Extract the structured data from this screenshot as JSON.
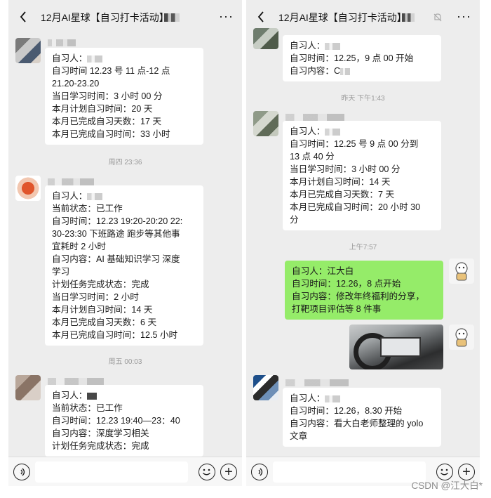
{
  "left": {
    "title": "12月AI星球【自习打卡活动】",
    "messages": [
      {
        "lines": [
          "自习人：",
          "自习时间   12.23 号 11 点-12 点",
          "21.20-23.20",
          "当日学习时间：3 小时 00 分",
          "本月计划自习时间：20 天",
          "本月已完成自习天数：17 天",
          "本月已完成自习时间：33 小时"
        ]
      },
      {
        "lines": [
          "自习人：",
          "当前状态：已工作",
          "自习时间：12.23 19:20-20:20 22:",
          "30-23:30 下班路途 跑步等其他事",
          "宜耗时 2 小时",
          "自习内容：AI 基础知识学习  深度",
          "学习",
          "计划任务完成状态：完成",
          "当日学习时间：2 小时",
          "本月计划自习时间：14 天",
          "本月已完成自习天数：6 天",
          "本月已完成自习时间：12.5 小时"
        ]
      },
      {
        "lines": [
          "自习人：",
          "当前状态：已工作",
          "自习时间：12.23 19:40—23：40",
          "自习内容：深度学习相关",
          "计划任务完成状态：完成"
        ]
      }
    ],
    "timestamps": [
      "周四 23:36",
      "周五 00:03"
    ]
  },
  "right": {
    "title": "12月AI星球【自习打卡活动】",
    "messages": [
      {
        "lines": [
          "自习人：",
          "自习时间：12.25，9 点 00 开始",
          "自习内容：C"
        ]
      },
      {
        "lines": [
          "自习人：",
          "自习时间：12.25 号 9 点 00 分到",
          "13 点 40 分",
          "当日学习时间：3 小时 00 分",
          "本月计划自习时间：14 天",
          "本月已完成自习天数：7 天",
          "本月已完成自习时间：20 小时 30",
          "分"
        ]
      },
      {
        "lines": [
          "自习人：江大白",
          "自习时间：12.26，8 点开始",
          "自习内容：修改年终福利的分享，",
          "打靶项目评估等 8 件事"
        ]
      },
      {
        "lines": [
          "自习人：",
          "自习时间：12.26，8.30 开始",
          "自习内容：看大白老师整理的 yolo",
          "文章"
        ]
      }
    ],
    "timestamps": [
      "昨天 下午1:43",
      "上午7:57"
    ]
  },
  "watermark": "CSDN @江大白*",
  "colors": {
    "bg": "#ededed",
    "bubble": "#ffffff",
    "self_bubble": "#95ec69",
    "timestamp": "#9a9a9a"
  },
  "icons": {
    "back": "chevron-left-icon",
    "more": "more-icon",
    "voice": "voice-icon",
    "emoji": "emoji-icon",
    "add": "plus-icon",
    "mute": "mute-icon"
  }
}
